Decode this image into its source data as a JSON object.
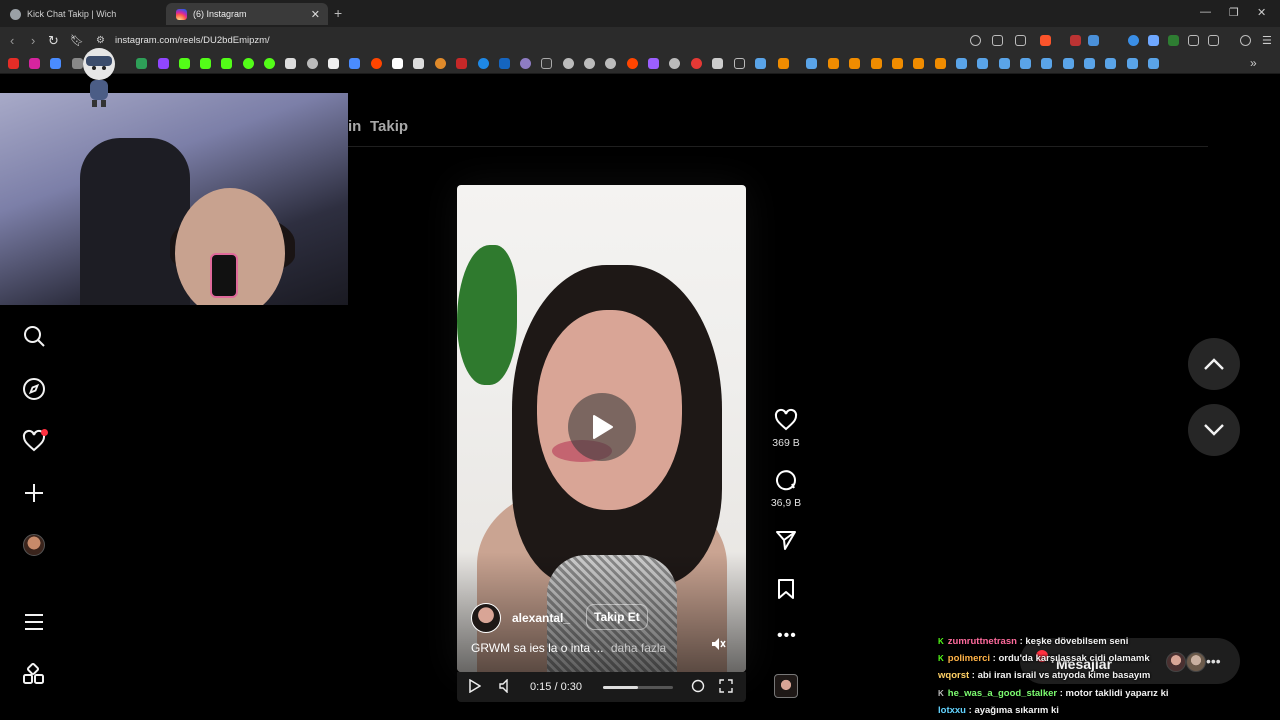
{
  "browser": {
    "tabs": [
      {
        "title": "Kick Chat Takip | Wich",
        "active": false
      },
      {
        "title": "(6) Instagram",
        "active": true
      }
    ],
    "url": "instagram.com/reels/DU2bdEmipzm/"
  },
  "page": {
    "topnav": {
      "partial": "in",
      "following": "Takip"
    },
    "sidebar": [
      "search-icon",
      "explore-icon",
      "notifications-icon",
      "create-icon",
      "profile-avatar",
      "menu-icon",
      "more-apps-icon"
    ]
  },
  "reel": {
    "username": "alexantal_",
    "follow_label": "Takip Et",
    "caption": "GRWM sa ies la o inta ...",
    "caption_more": "daha fazla",
    "time": "0:15 / 0:30",
    "progress": 0.5,
    "likes": "369 B",
    "comments": "36,9 B"
  },
  "messages": {
    "label": "Mesajlar"
  },
  "chat": [
    {
      "user": "zumruttnetrasn",
      "color": "#ff6b9d",
      "text": "keşke dövebilsem seni",
      "badge": "K"
    },
    {
      "user": "polimerci",
      "color": "#ffb347",
      "text": "ordu'da karşılaşsak cidi olamamk",
      "badge": "K"
    },
    {
      "user": "wqorst",
      "color": "#ffd166",
      "text": "abi iran israil vs atıyoda kime basayım",
      "badge": ""
    },
    {
      "user": "he_was_a_good_stalker",
      "color": "#7cfc70",
      "text": "motor taklidi yaparız ki",
      "badge": "K"
    },
    {
      "user": "lotxxu",
      "color": "#63d4ff",
      "text": "ayağıma sıkarım ki",
      "badge": ""
    }
  ]
}
